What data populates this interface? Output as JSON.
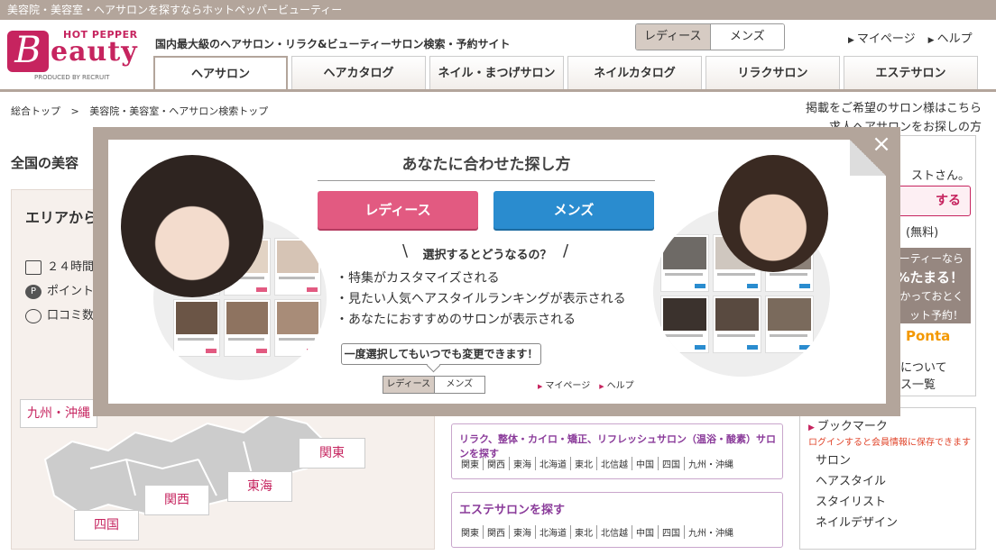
{
  "topbar": {
    "text": "美容院・美容室・ヘアサロンを探すならホットペッパービューティー"
  },
  "logo": {
    "hot_pepper": "HOT PEPPER",
    "b": "B",
    "eauty": "eauty",
    "produced": "PRODUCED BY RECRUIT"
  },
  "header": {
    "tagline": "国内最大級のヘアサロン・リラク&ビューティーサロン検索・予約サイト",
    "gender_ladies": "レディース",
    "gender_mens": "メンズ",
    "mypage": "マイページ",
    "help": "ヘルプ"
  },
  "tabs": [
    {
      "label": "ヘアサロン"
    },
    {
      "label": "ヘアカタログ"
    },
    {
      "label": "ネイル・まつげサロン"
    },
    {
      "label": "ネイルカタログ"
    },
    {
      "label": "リラクサロン"
    },
    {
      "label": "エステサロン"
    }
  ],
  "breadcrumb": {
    "home": "総合トップ",
    "sep": ">",
    "current": "美容院・美容室・ヘアサロン検索トップ"
  },
  "right_links": {
    "salon_owner": "掲載をご希望のサロン様はこちら",
    "recruit": "求人ヘアサロンをお探しの方"
  },
  "main": {
    "section_title": "全国の美容",
    "area_title": "エリアから",
    "features": [
      "２４時間",
      "ポイント",
      "口コミ数"
    ],
    "map_labels": [
      "九州・沖縄",
      "関東",
      "東海",
      "関西",
      "四国"
    ]
  },
  "search_boxes": [
    {
      "title": "リラク、整体・カイロ・矯正、リフレッシュサロン（温浴・酸素）サロンを探す",
      "regions": [
        "関東",
        "関西",
        "東海",
        "北海道",
        "東北",
        "北信越",
        "中国",
        "四国",
        "九州・沖縄"
      ]
    },
    {
      "title": "エステサロンを探す",
      "regions": [
        "関東",
        "関西",
        "東海",
        "北海道",
        "東北",
        "北信越",
        "中国",
        "四国",
        "九州・沖縄"
      ]
    }
  ],
  "sidebar": {
    "guest": "ストさん。",
    "login_btn": "する",
    "free": "(無料)",
    "promo_lines": [
      "ューティーなら",
      "2%たまる！",
      "かかっておとく",
      "ット予約！"
    ],
    "ponta": "Ponta",
    "about": "について",
    "list": "ス一覧",
    "bookmark_title": "ブックマーク",
    "bookmark_note": "ログインすると会員情報に保存できます",
    "bookmark_items": [
      "サロン",
      "ヘアスタイル",
      "スタイリスト",
      "ネイルデザイン"
    ]
  },
  "modal": {
    "title": "あなたに合わせた探し方",
    "ladies_button": "レディース",
    "mens_button": "メンズ",
    "question": "選択するとどうなるの？",
    "benefits": [
      "・特集がカスタマイズされる",
      "・見たい人気ヘアスタイルランキングが表示される",
      "・あなたにおすすめのサロンが表示される"
    ],
    "balloon": "一度選択してもいつでも変更できます！",
    "mini_ladies": "レディース",
    "mini_mens": "メンズ",
    "mini_mypage": "マイページ",
    "mini_help": "ヘルプ",
    "close": "×"
  },
  "colors": {
    "brand": "#c6245f",
    "ladies": "#e25a81",
    "mens": "#2a8ccf",
    "overlay": "#b3a59b",
    "relax": "#8a3b9a"
  }
}
